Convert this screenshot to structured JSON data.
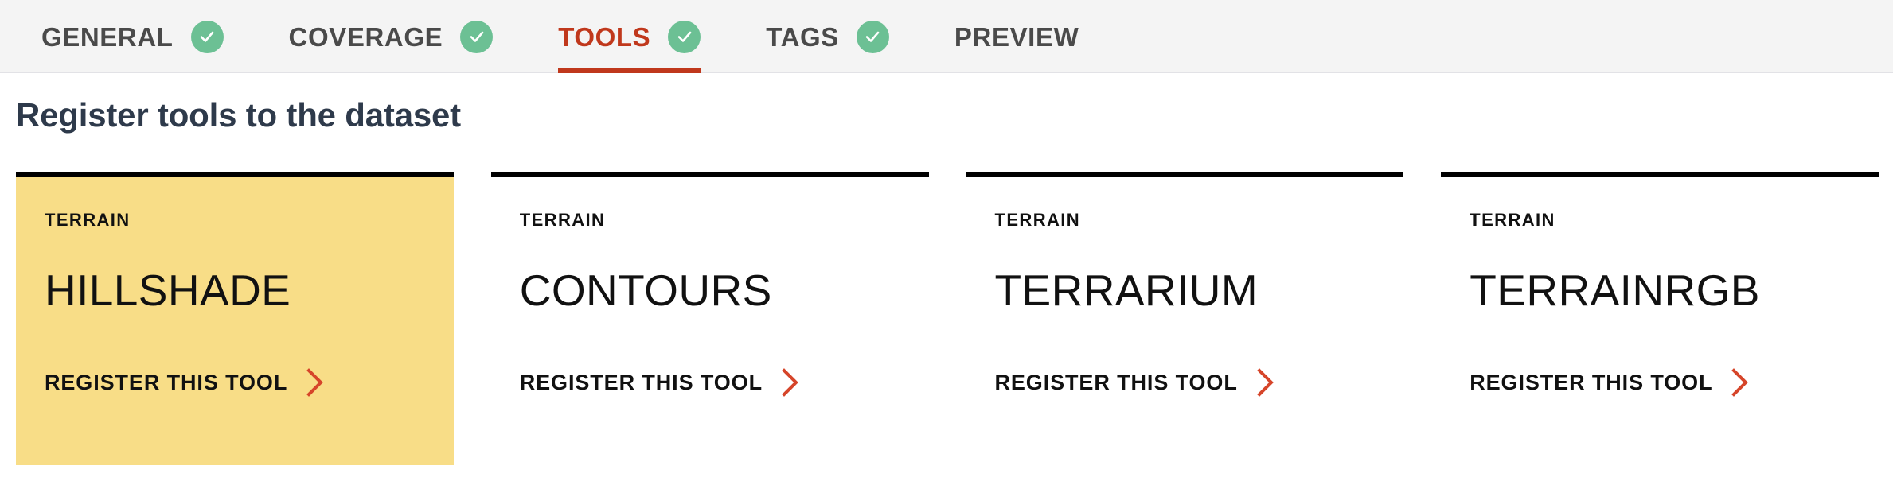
{
  "tabbar": {
    "tabs": [
      {
        "label": "GENERAL",
        "completed": true,
        "active": false
      },
      {
        "label": "COVERAGE",
        "completed": true,
        "active": false
      },
      {
        "label": "TOOLS",
        "completed": true,
        "active": true
      },
      {
        "label": "TAGS",
        "completed": true,
        "active": false
      },
      {
        "label": "PREVIEW",
        "completed": false,
        "active": false
      }
    ]
  },
  "page": {
    "title": "Register tools to the dataset"
  },
  "cards": [
    {
      "kicker": "TERRAIN",
      "title": "HILLSHADE",
      "cta": "REGISTER THIS TOOL",
      "highlighted": true
    },
    {
      "kicker": "TERRAIN",
      "title": "CONTOURS",
      "cta": "REGISTER THIS TOOL",
      "highlighted": false
    },
    {
      "kicker": "TERRAIN",
      "title": "TERRARIUM",
      "cta": "REGISTER THIS TOOL",
      "highlighted": false
    },
    {
      "kicker": "TERRAIN",
      "title": "TERRAINRGB",
      "cta": "REGISTER THIS TOOL",
      "highlighted": false
    }
  ],
  "colors": {
    "accent_red": "#c0381c",
    "chevron_red": "#d6452a",
    "badge_green": "#6cc094",
    "highlight_yellow": "#f8dd87",
    "tabbar_bg": "#f4f4f4",
    "heading_navy": "#2e3a4b",
    "card_rule_black": "#000000"
  },
  "icons": {
    "check": "check-icon",
    "chevron": "chevron-right-icon"
  }
}
